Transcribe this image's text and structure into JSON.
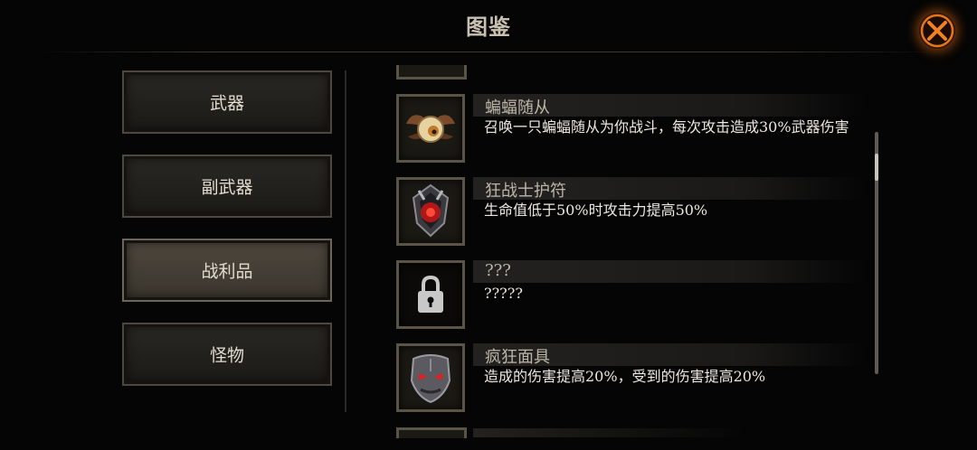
{
  "header": {
    "title": "图鉴"
  },
  "close": {
    "icon": "close-x-icon",
    "glow_color": "#e07018"
  },
  "categories": [
    {
      "label": "武器",
      "active": false
    },
    {
      "label": "副武器",
      "active": false
    },
    {
      "label": "战利品",
      "active": true
    },
    {
      "label": "怪物",
      "active": false
    }
  ],
  "items": [
    {
      "name": "蝙蝠随从",
      "desc": "召唤一只蝙蝠随从为你战斗，每次攻击造成30%武器伤害",
      "icon": "bat-companion-icon"
    },
    {
      "name": "狂战士护符",
      "desc": "生命值低于50%时攻击力提高50%",
      "icon": "berserker-amulet-icon"
    },
    {
      "name": "???",
      "desc": "?????",
      "icon": "padlock-icon"
    },
    {
      "name": "疯狂面具",
      "desc": "造成的伤害提高20%，受到的伤害提高20%",
      "icon": "mad-mask-icon"
    }
  ],
  "colors": {
    "accent": "#e07018",
    "frame": "#5a5348",
    "background": "#050505"
  }
}
